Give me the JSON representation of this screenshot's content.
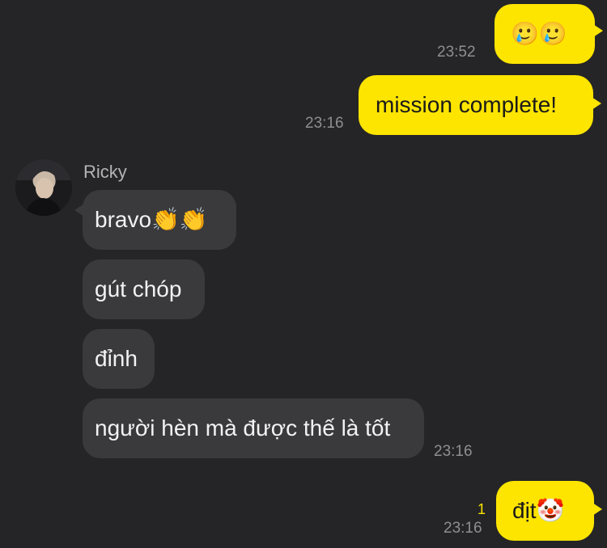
{
  "messages": {
    "m1": {
      "text": "🥲🥲",
      "time": "23:52"
    },
    "m2": {
      "text": "mission complete!",
      "time": "23:16"
    },
    "sender": {
      "name": "Ricky"
    },
    "m3": {
      "text": "bravo👏👏"
    },
    "m4": {
      "text": "gút chóp"
    },
    "m5": {
      "text": "đỉnh"
    },
    "m6": {
      "text": "người hèn mà được thế là tốt",
      "time": "23:16"
    },
    "m7": {
      "text": "địt🤡",
      "time": "23:16",
      "unread": "1"
    }
  },
  "colors": {
    "background": "#252527",
    "outgoing_bubble": "#fee500",
    "incoming_bubble": "#3a3a3c"
  }
}
